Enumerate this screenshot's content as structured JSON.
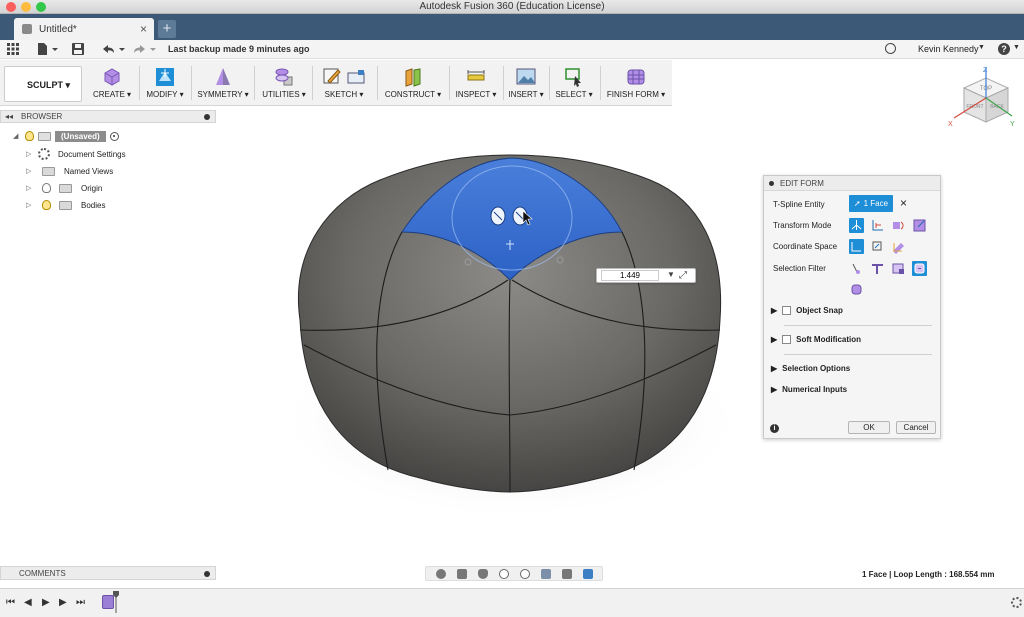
{
  "app": {
    "window_title": "Autodesk Fusion 360 (Education License)",
    "tab_label": "Untitled*",
    "new_tab_label": "+",
    "backup_text": "Last backup made 9 minutes ago",
    "user_name": "Kevin Kennedy",
    "help_label": "?"
  },
  "ribbon": {
    "workspace": "SCULPT",
    "groups": [
      {
        "label": "CREATE",
        "icon": "create-box-icon"
      },
      {
        "label": "MODIFY",
        "icon": "modify-edit-form-icon"
      },
      {
        "label": "SYMMETRY",
        "icon": "symmetry-icon"
      },
      {
        "label": "UTILITIES",
        "icon": "utilities-icon"
      },
      {
        "label": "SKETCH",
        "icon": "sketch-icon"
      },
      {
        "label": "CONSTRUCT",
        "icon": "construct-plane-icon"
      },
      {
        "label": "INSPECT",
        "icon": "inspect-measure-icon"
      },
      {
        "label": "INSERT",
        "icon": "insert-image-icon"
      },
      {
        "label": "SELECT",
        "icon": "select-window-icon"
      },
      {
        "label": "FINISH FORM",
        "icon": "finish-form-icon"
      }
    ]
  },
  "browser": {
    "title": "BROWSER",
    "items": [
      {
        "label": "(Unsaved)"
      },
      {
        "label": "Document Settings"
      },
      {
        "label": "Named Views"
      },
      {
        "label": "Origin"
      },
      {
        "label": "Bodies"
      }
    ]
  },
  "viewcube": {
    "top": "TOP",
    "front": "FRONT",
    "back": "BACK",
    "axis_z": "Z",
    "axis_x": "X",
    "axis_y": "Y"
  },
  "value_input": {
    "value": "1.449"
  },
  "edit_form": {
    "title": "EDIT FORM",
    "rows": {
      "tspline_entity": "T-Spline Entity",
      "face_button": "1 Face",
      "transform_mode": "Transform Mode",
      "coordinate_space": "Coordinate Space",
      "selection_filter": "Selection Filter"
    },
    "sections": {
      "object_snap": "Object Snap",
      "soft_modification": "Soft Modification",
      "selection_options": "Selection Options",
      "numerical_inputs": "Numerical Inputs"
    },
    "ok": "OK",
    "cancel": "Cancel",
    "info_label": "i",
    "accent": "#1e8ed6"
  },
  "comments": {
    "title": "COMMENTS"
  },
  "status": {
    "text": "1 Face | Loop Length : 168.554 mm"
  },
  "colors": {
    "selection_blue": "#3a73d4",
    "body_gray": "#6b6a67",
    "tab_bar": "#3c5a78"
  }
}
